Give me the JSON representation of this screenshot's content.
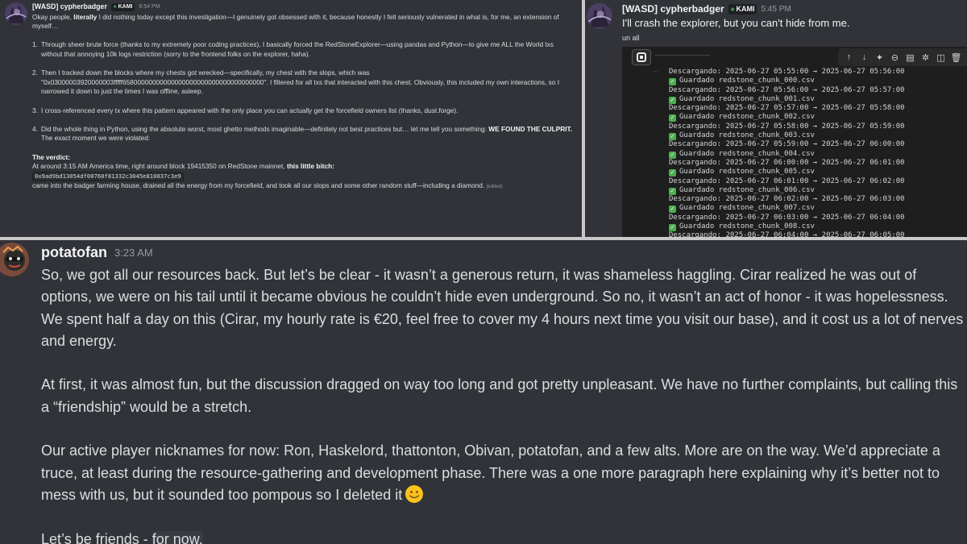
{
  "panel1": {
    "username": "[WASD] cypherbadger",
    "tag": "KAMI",
    "time": "6:54 PM",
    "intro_a": "Okay people, ",
    "intro_bold": "literally",
    "intro_b": " I did nothing today except this investigation—I genuinely got obsessed with it, because honestly I felt seriously vulnerated in what is, for me, an extension of myself…",
    "items": [
      {
        "num": "1.",
        "text": "Through sheer brute force (thanks to my extremely poor coding practices), I basically forced the RedStoneExplorer—using pandas and Python—to give me ALL the World txs without that annoying 10k logs restriction (sorry to the frontend folks on the explorer, haha)."
      },
      {
        "num": "2.",
        "text": "Then I tracked down the blocks where my chests got wrecked—specifically, my chest with the slops, which was \"0x03000003920000003fffff65800000000000000000000000000000000000\". I filtered for all txs that interacted with this chest. Obviously, this included my own interactions, so I narrowed it down to just the times I was offline, asleep."
      },
      {
        "num": "3.",
        "text": "I cross-referenced every tx where this pattern appeared with the only place you can actually get the forcefield owners list (thanks, dust.forge)."
      },
      {
        "num": "4.",
        "text": "Did the whole thing in Python, using the absolute worst, most ghetto methods imaginable—definitely not best practices but… let me tell you something: ",
        "bold": "WE FOUND THE CULPRIT.",
        "tail": " The exact moment we were violated:"
      }
    ],
    "verdict_label": "The verdict:",
    "verdict_a": "At around 3:15 AM America time, right around block 19415350 on RedStone mainnet, ",
    "verdict_bold": "this little bitch:",
    "address": "0x9ad9bd13054df00760f81332c3045e810037c3e9",
    "final": "came into the badger farming house, drained all the energy from my forcefield, and took all our slops and some other random stuff—including a diamond.",
    "edited": "(edited)"
  },
  "panel2": {
    "username": "[WASD] cypherbadger",
    "tag": "KAMI",
    "time": "5:45 PM",
    "message": "I'll crash the explorer, but you can't hide from me.",
    "cut_text": "un all",
    "toolbar_icons": [
      "arrow-up-icon",
      "arrow-down-icon",
      "sparkle-icon",
      "link-icon",
      "comment-icon",
      "settings-icon",
      "split-icon",
      "delete-icon"
    ],
    "output_lines": [
      {
        "type": "log",
        "text": "Descargando: 2025-06-27 05:55:00 → 2025-06-27 05:56:00"
      },
      {
        "type": "saved",
        "text": "Guardado redstone_chunk_000.csv"
      },
      {
        "type": "log",
        "text": "Descargando: 2025-06-27 05:56:00 → 2025-06-27 05:57:00"
      },
      {
        "type": "saved",
        "text": "Guardado redstone_chunk_001.csv"
      },
      {
        "type": "log",
        "text": "Descargando: 2025-06-27 05:57:00 → 2025-06-27 05:58:00"
      },
      {
        "type": "saved",
        "text": "Guardado redstone_chunk_002.csv"
      },
      {
        "type": "log",
        "text": "Descargando: 2025-06-27 05:58:00 → 2025-06-27 05:59:00"
      },
      {
        "type": "saved",
        "text": "Guardado redstone_chunk_003.csv"
      },
      {
        "type": "log",
        "text": "Descargando: 2025-06-27 05:59:00 → 2025-06-27 06:00:00"
      },
      {
        "type": "saved",
        "text": "Guardado redstone_chunk_004.csv"
      },
      {
        "type": "log",
        "text": "Descargando: 2025-06-27 06:00:00 → 2025-06-27 06:01:00"
      },
      {
        "type": "saved",
        "text": "Guardado redstone_chunk_005.csv"
      },
      {
        "type": "log",
        "text": "Descargando: 2025-06-27 06:01:00 → 2025-06-27 06:02:00"
      },
      {
        "type": "saved",
        "text": "Guardado redstone_chunk_006.csv"
      },
      {
        "type": "log",
        "text": "Descargando: 2025-06-27 06:02:00 → 2025-06-27 06:03:00"
      },
      {
        "type": "saved",
        "text": "Guardado redstone_chunk_007.csv"
      },
      {
        "type": "log",
        "text": "Descargando: 2025-06-27 06:03:00 → 2025-06-27 06:04:00"
      },
      {
        "type": "saved",
        "text": "Guardado redstone_chunk_008.csv"
      },
      {
        "type": "log",
        "text": "Descargando: 2025-06-27 06:04:00 → 2025-06-27 06:05:00"
      }
    ]
  },
  "panel3": {
    "username": "potatofan",
    "time": "3:23 AM",
    "p1": "So, we got all our resources back. But let’s be clear - it wasn’t a generous return, it was shameless haggling. Cirar realized he was out of options, we were on his tail until it became obvious he couldn’t hide even underground. So no, it wasn’t an act of honor - it was hopelessness. We spent half a day on this (Cirar, my hourly rate is €20, feel free to cover my 4 hours next time you visit our base), and it cost us a lot of nerves and energy.",
    "p2": "At first, it was almost fun, but the discussion dragged on way too long and got pretty unpleasant. We have no further complaints, but calling this a “friendship” would be a stretch.",
    "p3": "Our active player nicknames for now: Ron, Haskelord, thattonton, Obivan, potatofan, and a few alts. More are on the way. We’d appreciate a truce, at least during the resource-gathering and development phase. There was a one more paragraph here explaining why it’s better not to mess with us, but it sounded too pompous so I deleted it",
    "p4a": "Let’s be friends - ",
    "p4b": "for now."
  }
}
